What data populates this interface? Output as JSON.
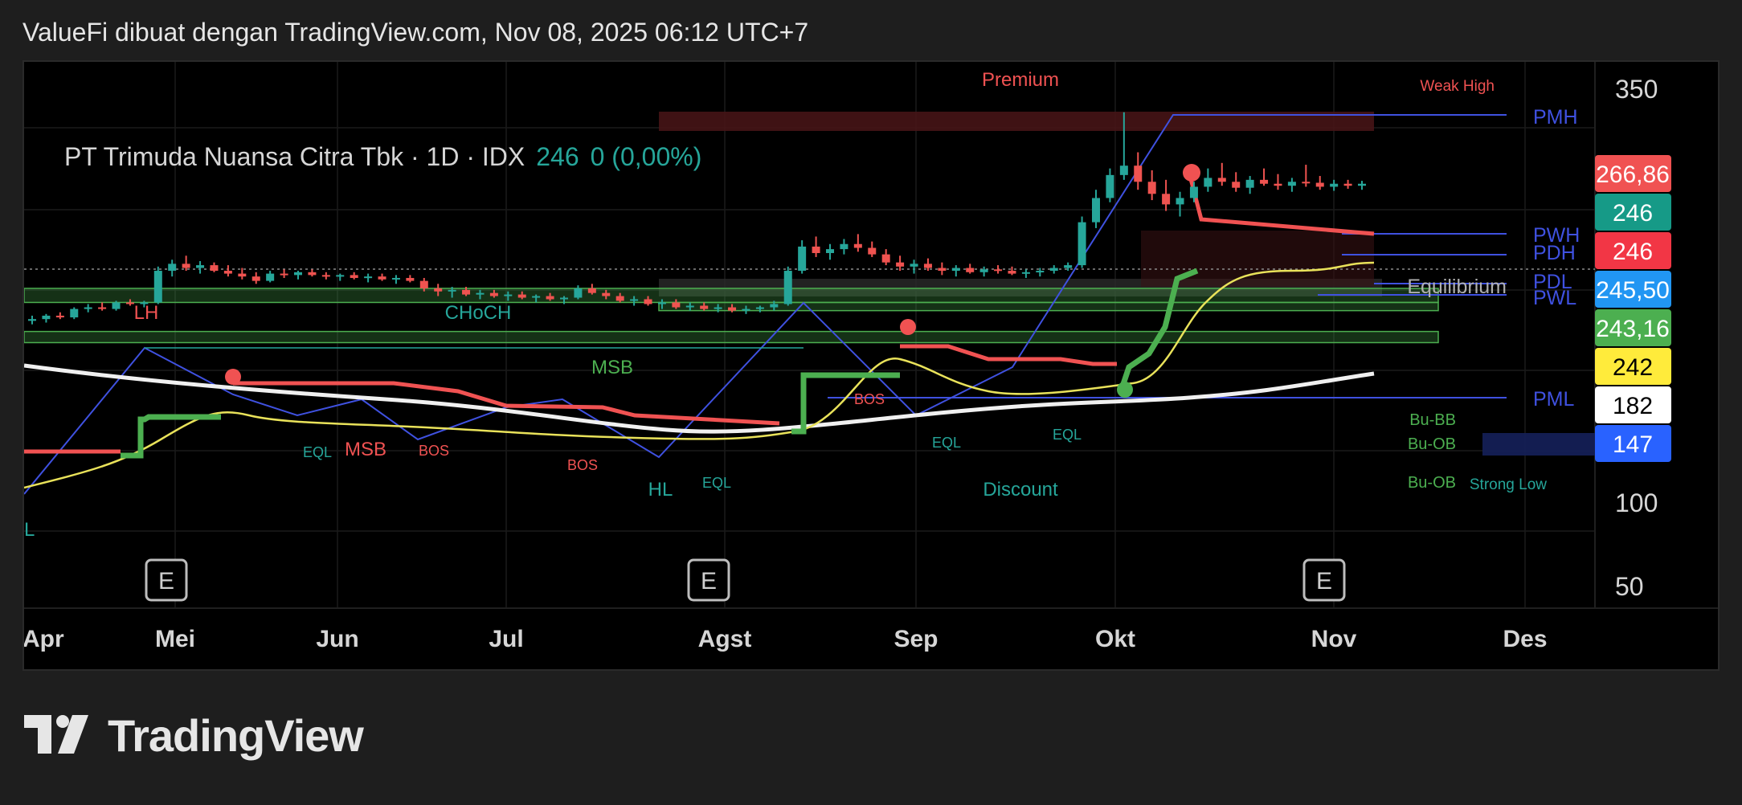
{
  "caption": "ValueFi dibuat dengan TradingView.com, Nov 08, 2025 06:12 UTC+7",
  "legend": {
    "symbol": "PT Trimuda Nuansa Citra Tbk · 1D · IDX",
    "last": "246",
    "change": "0 (0,00%)"
  },
  "logo_text": "TradingView",
  "colors": {
    "up": "#26a69a",
    "down": "#ef5350",
    "bullish_line": "#4caf50",
    "bearish_line": "#f05252",
    "structure_blue": "#3f51e0",
    "ema_yellow": "#e9e25a",
    "sma_white": "#f0f0f0"
  },
  "chart_data": {
    "type": "candlestick",
    "x_labels": [
      "Apr",
      "Mei",
      "Jun",
      "Jul",
      "Agst",
      "Sep",
      "Okt",
      "Nov",
      "Des"
    ],
    "y_ticks": [
      350,
      100,
      50
    ],
    "y_scale": "log",
    "y_range": [
      40,
      370
    ],
    "price_labels": [
      {
        "text": "266,86",
        "bg": "#f05252",
        "fg": "#ffffff"
      },
      {
        "text": "246",
        "bg": "#169a87",
        "fg": "#ffffff"
      },
      {
        "text": "246",
        "bg": "#f23645",
        "fg": "#ffffff"
      },
      {
        "text": "245,50",
        "bg": "#2196f3",
        "fg": "#ffffff"
      },
      {
        "text": "243,16",
        "bg": "#4caf50",
        "fg": "#ffffff"
      },
      {
        "text": "242",
        "bg": "#ffeb3b",
        "fg": "#000000"
      },
      {
        "text": "182",
        "bg": "#ffffff",
        "fg": "#000000"
      },
      {
        "text": "147",
        "bg": "#2962ff",
        "fg": "#ffffff"
      }
    ],
    "level_labels": [
      "PMH",
      "PWH",
      "PDH",
      "PDL",
      "PWL",
      "PML",
      "Equilibrium"
    ],
    "zone_labels": [
      "Premium",
      "Discount",
      "Weak High",
      "Strong Low",
      "Bu-BB",
      "Bu-OB",
      "Bu-OB"
    ],
    "structure_labels": [
      "LH",
      "CHoCH",
      "MSB",
      "MSB",
      "BOS",
      "BOS",
      "BOS",
      "EQL",
      "EQL",
      "EQL",
      "EQL",
      "HL",
      "L"
    ],
    "earnings_markers": [
      "E",
      "E",
      "E"
    ],
    "candles": [
      {
        "o": 140,
        "h": 143,
        "l": 138,
        "c": 141
      },
      {
        "o": 141,
        "h": 144,
        "l": 139,
        "c": 143
      },
      {
        "o": 143,
        "h": 145,
        "l": 141,
        "c": 142
      },
      {
        "o": 142,
        "h": 148,
        "l": 141,
        "c": 147
      },
      {
        "o": 147,
        "h": 150,
        "l": 145,
        "c": 148
      },
      {
        "o": 148,
        "h": 151,
        "l": 146,
        "c": 147
      },
      {
        "o": 147,
        "h": 152,
        "l": 146,
        "c": 151
      },
      {
        "o": 151,
        "h": 153,
        "l": 149,
        "c": 150
      },
      {
        "o": 150,
        "h": 152,
        "l": 148,
        "c": 151
      },
      {
        "o": 151,
        "h": 175,
        "l": 150,
        "c": 172
      },
      {
        "o": 172,
        "h": 180,
        "l": 168,
        "c": 177
      },
      {
        "o": 177,
        "h": 183,
        "l": 172,
        "c": 174
      },
      {
        "o": 174,
        "h": 179,
        "l": 170,
        "c": 176
      },
      {
        "o": 176,
        "h": 178,
        "l": 171,
        "c": 172
      },
      {
        "o": 172,
        "h": 176,
        "l": 168,
        "c": 170
      },
      {
        "o": 170,
        "h": 174,
        "l": 166,
        "c": 168
      },
      {
        "o": 168,
        "h": 171,
        "l": 163,
        "c": 165
      },
      {
        "o": 165,
        "h": 172,
        "l": 164,
        "c": 170
      },
      {
        "o": 170,
        "h": 173,
        "l": 167,
        "c": 169
      },
      {
        "o": 169,
        "h": 172,
        "l": 166,
        "c": 171
      },
      {
        "o": 171,
        "h": 173,
        "l": 168,
        "c": 169
      },
      {
        "o": 169,
        "h": 171,
        "l": 166,
        "c": 168
      },
      {
        "o": 168,
        "h": 170,
        "l": 165,
        "c": 169
      },
      {
        "o": 169,
        "h": 171,
        "l": 166,
        "c": 167
      },
      {
        "o": 167,
        "h": 170,
        "l": 164,
        "c": 168
      },
      {
        "o": 168,
        "h": 170,
        "l": 165,
        "c": 166
      },
      {
        "o": 166,
        "h": 169,
        "l": 163,
        "c": 167
      },
      {
        "o": 167,
        "h": 169,
        "l": 164,
        "c": 165
      },
      {
        "o": 165,
        "h": 167,
        "l": 158,
        "c": 160
      },
      {
        "o": 160,
        "h": 163,
        "l": 155,
        "c": 158
      },
      {
        "o": 158,
        "h": 161,
        "l": 154,
        "c": 159
      },
      {
        "o": 159,
        "h": 161,
        "l": 155,
        "c": 156
      },
      {
        "o": 156,
        "h": 159,
        "l": 153,
        "c": 157
      },
      {
        "o": 157,
        "h": 159,
        "l": 154,
        "c": 155
      },
      {
        "o": 155,
        "h": 158,
        "l": 152,
        "c": 156
      },
      {
        "o": 156,
        "h": 158,
        "l": 153,
        "c": 154
      },
      {
        "o": 154,
        "h": 156,
        "l": 151,
        "c": 155
      },
      {
        "o": 155,
        "h": 157,
        "l": 152,
        "c": 153
      },
      {
        "o": 153,
        "h": 155,
        "l": 150,
        "c": 154
      },
      {
        "o": 154,
        "h": 162,
        "l": 153,
        "c": 160
      },
      {
        "o": 160,
        "h": 163,
        "l": 156,
        "c": 157
      },
      {
        "o": 157,
        "h": 159,
        "l": 153,
        "c": 155
      },
      {
        "o": 155,
        "h": 157,
        "l": 151,
        "c": 152
      },
      {
        "o": 152,
        "h": 155,
        "l": 149,
        "c": 153
      },
      {
        "o": 153,
        "h": 155,
        "l": 149,
        "c": 150
      },
      {
        "o": 150,
        "h": 153,
        "l": 147,
        "c": 151
      },
      {
        "o": 151,
        "h": 153,
        "l": 147,
        "c": 148
      },
      {
        "o": 148,
        "h": 151,
        "l": 146,
        "c": 149
      },
      {
        "o": 149,
        "h": 151,
        "l": 146,
        "c": 147
      },
      {
        "o": 147,
        "h": 150,
        "l": 145,
        "c": 148
      },
      {
        "o": 148,
        "h": 150,
        "l": 145,
        "c": 146
      },
      {
        "o": 146,
        "h": 149,
        "l": 144,
        "c": 147
      },
      {
        "o": 147,
        "h": 149,
        "l": 145,
        "c": 148
      },
      {
        "o": 148,
        "h": 152,
        "l": 146,
        "c": 150
      },
      {
        "o": 150,
        "h": 175,
        "l": 149,
        "c": 172
      },
      {
        "o": 172,
        "h": 195,
        "l": 170,
        "c": 190
      },
      {
        "o": 190,
        "h": 198,
        "l": 182,
        "c": 185
      },
      {
        "o": 185,
        "h": 192,
        "l": 180,
        "c": 188
      },
      {
        "o": 188,
        "h": 196,
        "l": 184,
        "c": 192
      },
      {
        "o": 192,
        "h": 200,
        "l": 186,
        "c": 189
      },
      {
        "o": 189,
        "h": 194,
        "l": 182,
        "c": 184
      },
      {
        "o": 184,
        "h": 188,
        "l": 176,
        "c": 178
      },
      {
        "o": 178,
        "h": 183,
        "l": 172,
        "c": 175
      },
      {
        "o": 175,
        "h": 180,
        "l": 170,
        "c": 177
      },
      {
        "o": 177,
        "h": 181,
        "l": 172,
        "c": 174
      },
      {
        "o": 174,
        "h": 178,
        "l": 169,
        "c": 172
      },
      {
        "o": 172,
        "h": 176,
        "l": 168,
        "c": 174
      },
      {
        "o": 174,
        "h": 177,
        "l": 170,
        "c": 171
      },
      {
        "o": 171,
        "h": 175,
        "l": 168,
        "c": 173
      },
      {
        "o": 173,
        "h": 176,
        "l": 170,
        "c": 172
      },
      {
        "o": 172,
        "h": 175,
        "l": 169,
        "c": 170
      },
      {
        "o": 170,
        "h": 173,
        "l": 167,
        "c": 171
      },
      {
        "o": 171,
        "h": 174,
        "l": 168,
        "c": 172
      },
      {
        "o": 172,
        "h": 176,
        "l": 170,
        "c": 174
      },
      {
        "o": 174,
        "h": 178,
        "l": 172,
        "c": 176
      },
      {
        "o": 176,
        "h": 215,
        "l": 174,
        "c": 210
      },
      {
        "o": 210,
        "h": 240,
        "l": 205,
        "c": 232
      },
      {
        "o": 232,
        "h": 262,
        "l": 228,
        "c": 255
      },
      {
        "o": 255,
        "h": 330,
        "l": 250,
        "c": 265
      },
      {
        "o": 265,
        "h": 280,
        "l": 240,
        "c": 248
      },
      {
        "o": 248,
        "h": 260,
        "l": 230,
        "c": 236
      },
      {
        "o": 236,
        "h": 250,
        "l": 220,
        "c": 226
      },
      {
        "o": 226,
        "h": 238,
        "l": 215,
        "c": 232
      },
      {
        "o": 232,
        "h": 248,
        "l": 228,
        "c": 243
      },
      {
        "o": 243,
        "h": 262,
        "l": 238,
        "c": 252
      },
      {
        "o": 252,
        "h": 268,
        "l": 244,
        "c": 248
      },
      {
        "o": 248,
        "h": 258,
        "l": 238,
        "c": 242
      },
      {
        "o": 242,
        "h": 254,
        "l": 236,
        "c": 250
      },
      {
        "o": 250,
        "h": 262,
        "l": 244,
        "c": 246
      },
      {
        "o": 246,
        "h": 256,
        "l": 240,
        "c": 244
      },
      {
        "o": 244,
        "h": 252,
        "l": 238,
        "c": 248
      },
      {
        "o": 248,
        "h": 266,
        "l": 243,
        "c": 247
      },
      {
        "o": 247,
        "h": 254,
        "l": 240,
        "c": 243
      },
      {
        "o": 243,
        "h": 250,
        "l": 239,
        "c": 246
      },
      {
        "o": 246,
        "h": 250,
        "l": 241,
        "c": 244
      },
      {
        "o": 244,
        "h": 249,
        "l": 240,
        "c": 246
      }
    ],
    "sma_white": [
      108,
      112,
      116,
      118,
      120,
      121,
      122,
      123,
      124,
      125,
      126,
      128,
      131,
      134,
      137,
      141,
      145,
      150,
      156,
      163,
      170,
      175,
      182
    ],
    "ema_yellow": [
      142,
      145,
      150,
      158,
      164,
      168,
      167,
      164,
      160,
      156,
      152,
      150,
      149,
      150,
      158,
      175,
      180,
      176,
      172,
      174,
      190,
      232,
      243,
      244,
      242,
      244
    ],
    "ob_zones": [
      {
        "label": "Bu-BB",
        "low": 151,
        "high": 160,
        "color": "#4caf50"
      },
      {
        "label": "Bu-OB",
        "low": 146,
        "high": 151,
        "color": "#4caf50"
      },
      {
        "label": "Bu-OB",
        "low": 128,
        "high": 134,
        "color": "#4caf50"
      }
    ],
    "levels": {
      "PMH": 330,
      "PWH": 251,
      "PDH": 248,
      "PDL": 244,
      "PWL": 243,
      "PML": 175
    }
  }
}
